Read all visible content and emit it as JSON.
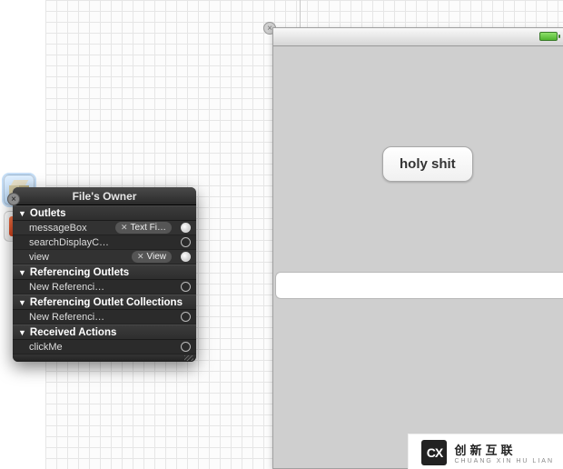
{
  "dock": {
    "items": [
      {
        "name": "files-owner-cube",
        "selected": true
      },
      {
        "name": "first-responder",
        "selected": false
      }
    ]
  },
  "device": {
    "close_glyph": "×",
    "button_label": "holy shit",
    "textfield_value": ""
  },
  "hud": {
    "close_glyph": "×",
    "title": "File's Owner",
    "sections": [
      {
        "title": "Outlets",
        "rows": [
          {
            "label": "messageBox",
            "connection": "Text Fi…",
            "connected": true
          },
          {
            "label": "searchDisplayController",
            "connection": "",
            "connected": false
          },
          {
            "label": "view",
            "connection": "View",
            "connected": true
          }
        ]
      },
      {
        "title": "Referencing Outlets",
        "rows": [
          {
            "label": "New Referencing Outlet",
            "connection": "",
            "connected": false
          }
        ]
      },
      {
        "title": "Referencing Outlet Collections",
        "rows": [
          {
            "label": "New Referencing Outlet Colle…",
            "connection": "",
            "connected": false
          }
        ]
      },
      {
        "title": "Received Actions",
        "rows": [
          {
            "label": "clickMe",
            "connection": "",
            "connected": false
          }
        ]
      }
    ]
  },
  "watermark": {
    "logo": "CX",
    "line1": "创新互联",
    "line2": "CHUANG XIN HU LIAN"
  }
}
